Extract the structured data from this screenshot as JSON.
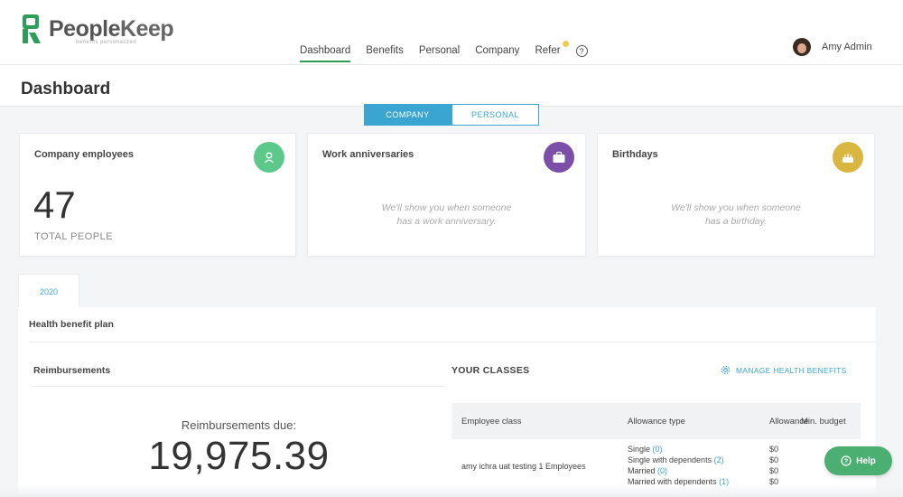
{
  "brand": {
    "name_people": "People",
    "name_keep": "Keep",
    "tagline": "benefits personalized",
    "color": "#2e9d5a"
  },
  "nav": {
    "items": [
      {
        "label": "Dashboard",
        "active": true
      },
      {
        "label": "Benefits"
      },
      {
        "label": "Personal"
      },
      {
        "label": "Company"
      },
      {
        "label": "Refer"
      }
    ],
    "help_glyph": "?"
  },
  "user": {
    "name": "Amy Admin"
  },
  "page": {
    "title": "Dashboard"
  },
  "toggle": {
    "company": "COMPANY",
    "personal": "PERSONAL",
    "selected": "COMPANY"
  },
  "cards": {
    "employees": {
      "title": "Company employees",
      "value": "47",
      "sub": "TOTAL PEOPLE",
      "icon": "person-icon",
      "color": "#5cc98a"
    },
    "anniversaries": {
      "title": "Work anniversaries",
      "msg1": "We'll show you when someone",
      "msg2": "has a work anniversary.",
      "icon": "briefcase-icon",
      "color": "#7b4fa8"
    },
    "birthdays": {
      "title": "Birthdays",
      "msg1": "We'll show you when someone",
      "msg2": "has a birthday.",
      "icon": "cake-icon",
      "color": "#d9b640"
    }
  },
  "year_tab": "2020",
  "plan": {
    "title": "Health benefit plan",
    "reimbursements": {
      "title": "Reimbursements",
      "due_label": "Reimbursements due:",
      "due_value": "19,975.39"
    },
    "classes": {
      "title": "YOUR CLASSES",
      "manage_link": "MANAGE HEALTH BENEFITS",
      "headers": {
        "class": "Employee class",
        "allowance_type": "Allowance type",
        "allowance": "Allowance",
        "min_budget": "Min. budget"
      },
      "row": {
        "class": "amy ichra uat testing 1 Employees",
        "types": [
          {
            "label": "Single",
            "count": "(0)",
            "amount": "$0"
          },
          {
            "label": "Single with dependents",
            "count": "(2)",
            "amount": "$0"
          },
          {
            "label": "Married",
            "count": "(0)",
            "amount": "$0"
          },
          {
            "label": "Married with dependents",
            "count": "(1)",
            "amount": "$0"
          }
        ]
      }
    }
  },
  "help_button": "Help"
}
